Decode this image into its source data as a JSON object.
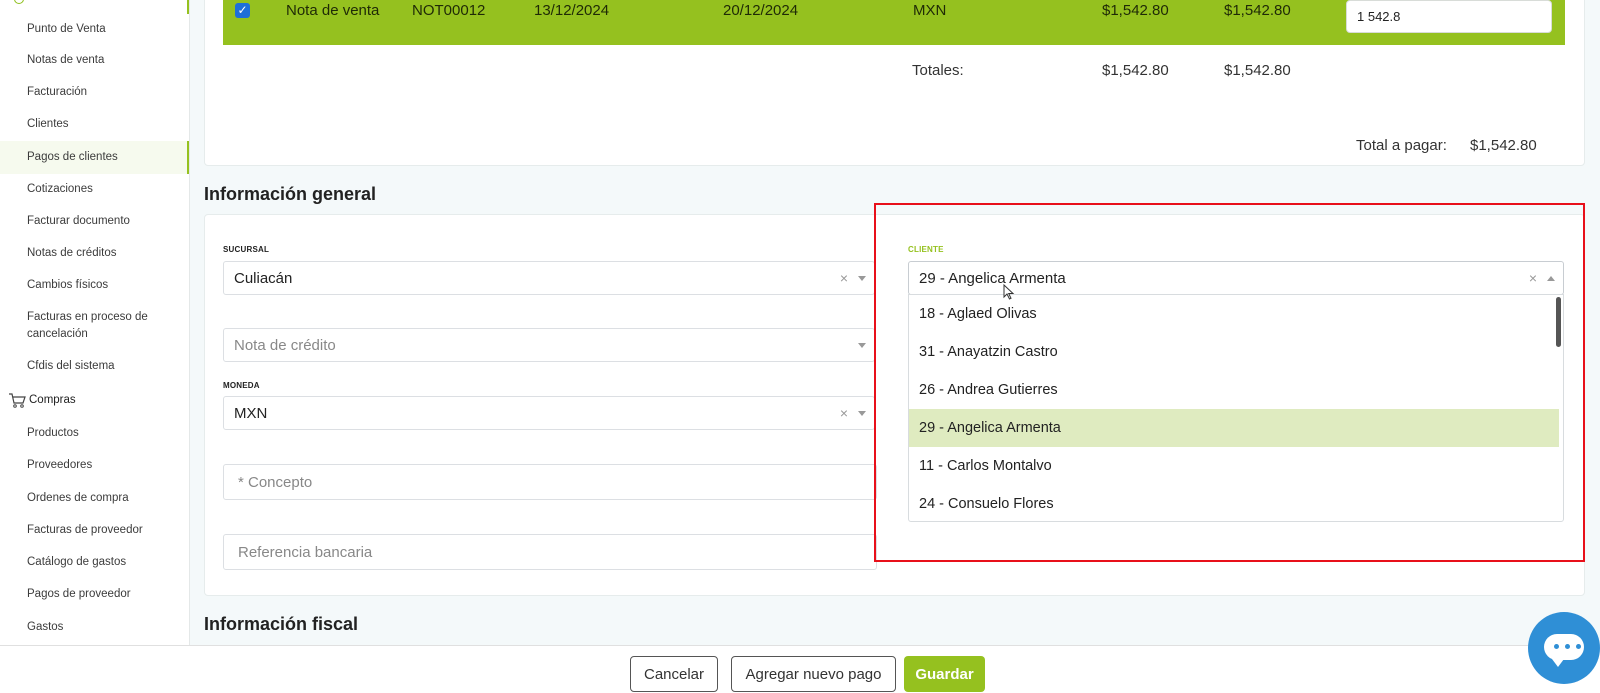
{
  "sidebar": {
    "items": [
      {
        "label": "Punto de Venta"
      },
      {
        "label": "Notas de venta"
      },
      {
        "label": "Facturación"
      },
      {
        "label": "Clientes"
      },
      {
        "label": "Pagos de clientes"
      },
      {
        "label": "Cotizaciones"
      },
      {
        "label": "Facturar documento"
      },
      {
        "label": "Notas de créditos"
      },
      {
        "label": "Cambios físicos"
      },
      {
        "label": "Facturas en proceso de"
      },
      {
        "label": "cancelación"
      },
      {
        "label": "Cfdis del sistema"
      },
      {
        "label": "Compras"
      },
      {
        "label": "Productos"
      },
      {
        "label": "Proveedores"
      },
      {
        "label": "Ordenes de compra"
      },
      {
        "label": "Facturas de proveedor"
      },
      {
        "label": "Catálogo de gastos"
      },
      {
        "label": "Pagos de proveedor"
      },
      {
        "label": "Gastos"
      }
    ],
    "active_label": "Pagos de clientes",
    "compras_icon": "cart-icon"
  },
  "table": {
    "row": {
      "checked": true,
      "tipo": "Nota de venta",
      "folio": "NOT00012",
      "fecha": "13/12/2024",
      "vencimiento": "20/12/2024",
      "moneda": "MXN",
      "total": "$1,542.80",
      "saldo": "$1,542.80",
      "monto_input": "1 542.8"
    },
    "totales_label": "Totales:",
    "totales_total": "$1,542.80",
    "totales_saldo": "$1,542.80",
    "total_pagar_label": "Total a pagar:",
    "total_pagar_value": "$1,542.80"
  },
  "general": {
    "title": "Información general",
    "sucursal_label": "SUCURSAL",
    "sucursal_value": "Culiacán",
    "nota_credito_placeholder": "Nota de crédito",
    "moneda_label": "MONEDA",
    "moneda_value": "MXN",
    "concepto_placeholder": "* Concepto",
    "referencia_placeholder": "Referencia bancaria",
    "cliente_label": "CLIENTE",
    "cliente_value": "29 - Angelica Armenta",
    "cliente_options": [
      "18 - Aglaed Olivas",
      "31 - Anayatzin Castro",
      "26 - Andrea Gutierres",
      "29 - Angelica Armenta",
      "11 - Carlos Montalvo",
      "24 - Consuelo Flores"
    ],
    "selected_option": "29 - Angelica Armenta"
  },
  "fiscal": {
    "title": "Información fiscal"
  },
  "footer": {
    "cancel_label": "Cancelar",
    "add_payment_label": "Agregar nuevo pago",
    "save_label": "Guardar"
  },
  "colors": {
    "accent": "#95c11f",
    "selected_option": "#dfebc0",
    "highlight": "#e8101a",
    "chat": "#2f8fd6"
  },
  "icons": {
    "chat": "chat-icon",
    "clear": "clear-icon",
    "chevron": "chevron-icon"
  }
}
